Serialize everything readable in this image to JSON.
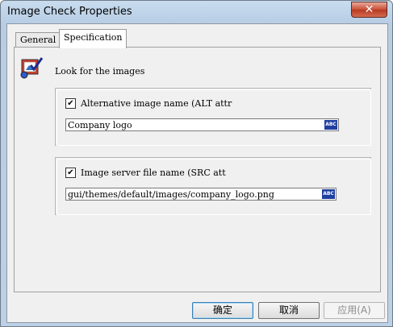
{
  "window": {
    "title": "Image Check Properties"
  },
  "tabs": [
    {
      "label": "General"
    },
    {
      "label": "Specification"
    }
  ],
  "header": {
    "label": "Look for the images"
  },
  "alt_group": {
    "checkbox_label": "Alternative image name (ALT attr",
    "checked": true,
    "value": "Company logo",
    "button_label": "ABC"
  },
  "src_group": {
    "checkbox_label": "Image server file name (SRC att",
    "checked": true,
    "value": "gui/themes/default/images/company_logo.png",
    "button_label": "ABC"
  },
  "buttons": {
    "ok": "确定",
    "cancel": "取消",
    "apply": "应用(A)"
  },
  "icons": {
    "check": "✔",
    "close": "✕"
  }
}
